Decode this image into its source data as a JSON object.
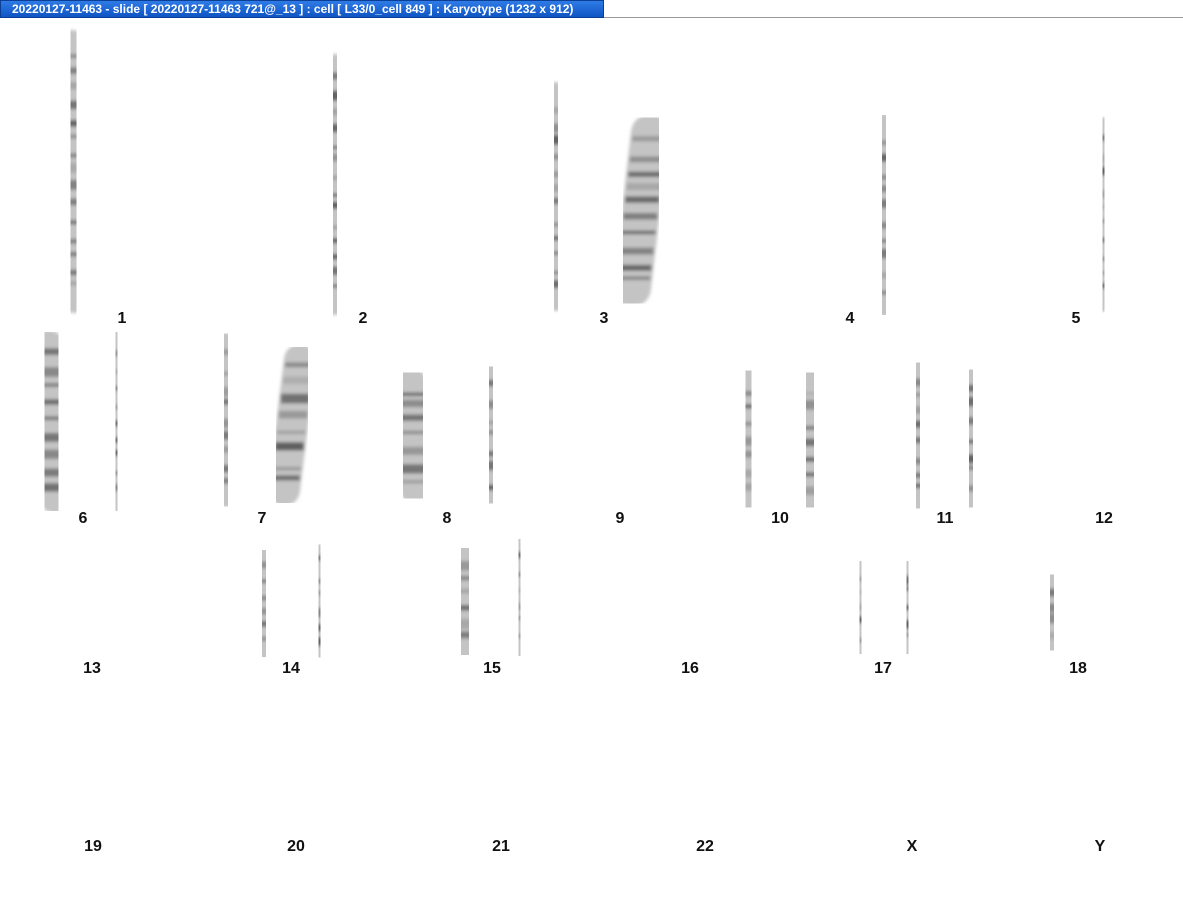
{
  "window": {
    "title": "20220127-11463 - slide [ 20220127-11463 721@_13 ] : cell [ L33/0_cell 849 ] : Karyotype  (1232 x 912)"
  },
  "karyotype": {
    "labels": [
      "1",
      "2",
      "3",
      "4",
      "5",
      "6",
      "7",
      "8",
      "9",
      "10",
      "11",
      "12",
      "13",
      "14",
      "15",
      "16",
      "17",
      "18",
      "19",
      "20",
      "21",
      "22",
      "X",
      "Y"
    ]
  }
}
